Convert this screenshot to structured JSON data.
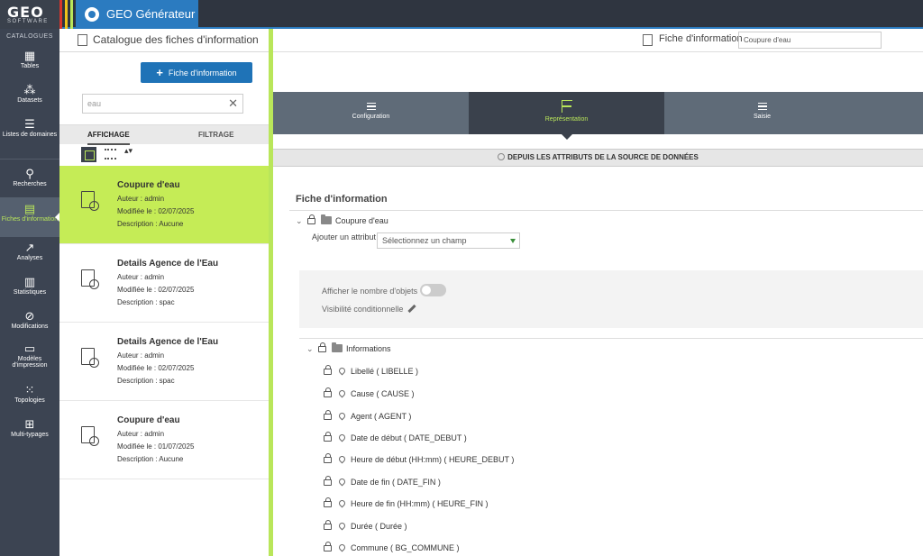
{
  "logo": {
    "main": "GEO",
    "sub": "SOFTWARE"
  },
  "app": {
    "title": "GEO Générateur"
  },
  "nav": {
    "title": "CATALOGUES",
    "items": [
      {
        "label": "Tables",
        "icon": "tables-icon",
        "glyph": "▦"
      },
      {
        "label": "Datasets",
        "icon": "datasets-icon",
        "glyph": "⁂"
      },
      {
        "label": "Listes de domaines",
        "icon": "list-icon",
        "glyph": "☰"
      },
      {
        "label": "Recherches",
        "icon": "search-icon",
        "glyph": "⚲"
      },
      {
        "label": "Fiches d'information",
        "icon": "info-sheet-icon",
        "glyph": "▤"
      },
      {
        "label": "Analyses",
        "icon": "analyses-icon",
        "glyph": "↗"
      },
      {
        "label": "Statistiques",
        "icon": "statistics-icon",
        "glyph": "▥"
      },
      {
        "label": "Modifications",
        "icon": "modifications-icon",
        "glyph": "⊘"
      },
      {
        "label": "Modèles d'impression",
        "icon": "print-template-icon",
        "glyph": "▭"
      },
      {
        "label": "Topologies",
        "icon": "topologies-icon",
        "glyph": "⁙"
      },
      {
        "label": "Multi-typages",
        "icon": "multi-types-icon",
        "glyph": "⊞"
      }
    ]
  },
  "catalog": {
    "title": "Catalogue des fiches d'information",
    "new_button": "Fiche d'information",
    "search_value": "eau",
    "tabs": [
      "AFFICHAGE",
      "FILTRAGE"
    ],
    "cards": [
      {
        "title": "Coupure d'eau",
        "author": "Auteur : admin",
        "modified": "Modifiée le : 02/07/2025",
        "description": "Description : Aucune"
      },
      {
        "title": "Details Agence de l'Eau",
        "author": "Auteur : admin",
        "modified": "Modifiée le : 02/07/2025",
        "description": "Description : spac"
      },
      {
        "title": "Details Agence de l'Eau",
        "author": "Auteur : admin",
        "modified": "Modifiée le : 02/07/2025",
        "description": "Description : spac"
      },
      {
        "title": "Coupure d'eau",
        "author": "Auteur : admin",
        "modified": "Modifiée le : 01/07/2025",
        "description": "Description : Aucune"
      }
    ]
  },
  "main": {
    "header_label": "Fiche d'information",
    "header_value": "Coupure d'eau",
    "steps": [
      "Configuration",
      "Représentation",
      "Saisie"
    ],
    "source_label": "DEPUIS LES ATTRIBUTS DE LA SOURCE DE DONNÉES",
    "fiche_title": "Fiche d'information",
    "root_node": "Coupure d'eau",
    "add_attr_label": "Ajouter un attribut",
    "add_attr_placeholder": "Sélectionnez un champ",
    "show_count_label": "Afficher le nombre d'objets",
    "conditional_label": "Visibilité conditionnelle",
    "group_node": "Informations",
    "attributes": [
      "Libellé ( LIBELLE )",
      "Cause ( CAUSE )",
      "Agent ( AGENT )",
      "Date de début ( DATE_DEBUT )",
      "Heure de début (HH:mm) ( HEURE_DEBUT )",
      "Date de fin ( DATE_FIN )",
      "Heure de fin (HH:mm) ( HEURE_FIN )",
      "Durée ( Durée )",
      "Commune ( BG_COMMUNE )"
    ]
  },
  "colors": {
    "accent": "#b9e65a",
    "primary": "#1f73b7",
    "nav_bg": "#3c4452"
  }
}
